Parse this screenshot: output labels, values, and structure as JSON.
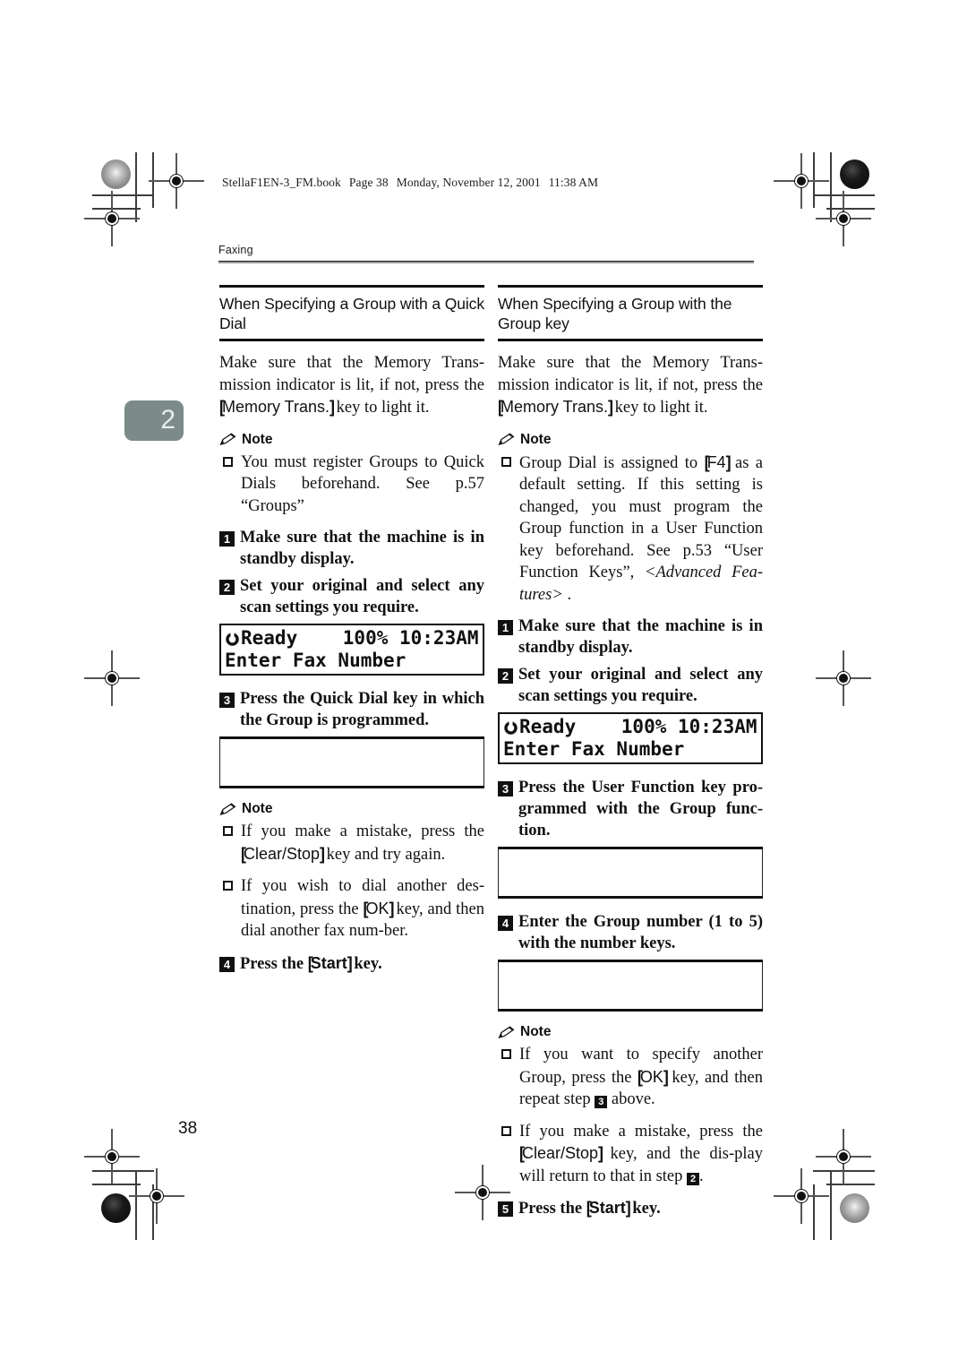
{
  "header": {
    "file_info": [
      "StellaF1EN-3_FM.book",
      "Page 38",
      "Monday, November 12, 2001",
      "11:38 AM"
    ],
    "running_head": "Faxing"
  },
  "chapter_tab": "2",
  "page_number": "38",
  "note_label": "Note",
  "lcd": {
    "line1": "Ready    100% 10:23AM",
    "line2": "Enter Fax Number",
    "power_icon": "power-standby-icon"
  },
  "left_column": {
    "title": "When Specifying a Group with a Quick Dial",
    "intro_a": "Make sure that the Memory Trans-mission indicator is lit, if not, press the ",
    "intro_key": "Memory Trans.",
    "intro_b": " key to light it.",
    "note1_item1": "You must register Groups to Quick Dials beforehand. See p.57 “Groups”",
    "step1_num": "1",
    "step1": "Make sure that the machine is in standby display.",
    "step2_num": "2",
    "step2": "Set your original and select any scan settings you require.",
    "step3_num": "3",
    "step3": "Press the Quick Dial key in which the Group is programmed.",
    "note2_item1_a": "If you make a mistake, press the ",
    "note2_item1_key": "Clear/Stop",
    "note2_item1_b": " key and try again.",
    "note2_item2_a": "If you wish to dial another des-tination, press the ",
    "note2_item2_key": "OK",
    "note2_item2_b": " key, and then dial another fax num-ber.",
    "step4_num": "4",
    "step4_a": "Press the ",
    "step4_key": "Start",
    "step4_b": " key."
  },
  "right_column": {
    "title": "When Specifying a Group with the Group key",
    "intro_a": "Make sure that the Memory Trans-mission indicator is lit, if not, press the ",
    "intro_key": "Memory Trans.",
    "intro_b": " key to light it.",
    "note1_item1_a": "Group Dial is assigned to ",
    "note1_item1_key": "F4",
    "note1_item1_b": " as a default setting. If this setting is changed, you must program the Group function in a User Function key beforehand. See p.53 “User Function Keys”, ",
    "note1_item1_ital": "<Advanced Fea-tures>",
    "note1_item1_c": " .",
    "step1_num": "1",
    "step1": "Make sure that the machine is in standby display.",
    "step2_num": "2",
    "step2": "Set your original and select any scan settings you require.",
    "step3_num": "3",
    "step3": "Press the User Function key pro-grammed with the Group func-tion.",
    "step4_num": "4",
    "step4": "Enter the Group number (1 to 5) with the number keys.",
    "note2_item1_a": "If you want to specify another Group, press the ",
    "note2_item1_key": "OK",
    "note2_item1_b": " key, and then repeat step ",
    "note2_item1_step": "3",
    "note2_item1_c": " above.",
    "note2_item2_a": "If you make a mistake, press the ",
    "note2_item2_key": "Clear/Stop",
    "note2_item2_b": " key, and the dis-play will return to that in step ",
    "note2_item2_step": "2",
    "note2_item2_c": ".",
    "step5_num": "5",
    "step5_a": "Press the ",
    "step5_key": "Start",
    "step5_b": " key."
  }
}
